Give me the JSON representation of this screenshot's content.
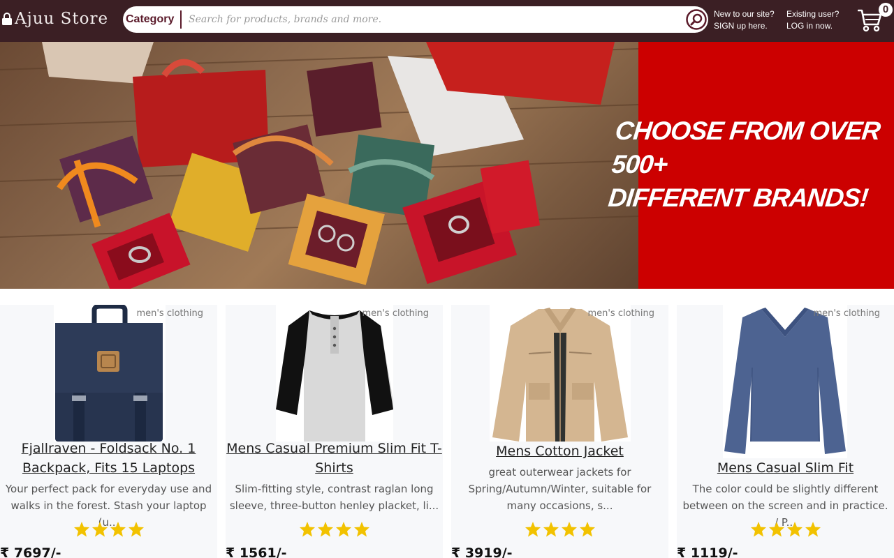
{
  "header": {
    "brand": "Ajuu Store",
    "category_label": "Category",
    "search_placeholder": "Search for products, brands and more.",
    "signup_line1": "New to our site?",
    "signup_line2": "SIGN up here.",
    "login_line1": "Existing user?",
    "login_line2": "LOG in now.",
    "cart_count": "0",
    "colors": {
      "bar": "#3b1f24",
      "accent": "#5a1a2a"
    }
  },
  "banner": {
    "line1": "CHOOSE FROM OVER",
    "line2": "500+",
    "line3": "DIFFERENT BRANDS!",
    "colors": {
      "panel": "#cc0000"
    }
  },
  "products": [
    {
      "category": "men's clothing",
      "title": "Fjallraven - Foldsack No. 1 Backpack, Fits 15 Laptops",
      "description": "Your perfect pack for everyday use and walks in the forest. Stash your laptop (u...",
      "rating": 4,
      "price": "₹ 7697/-",
      "icon": "backpack-image"
    },
    {
      "category": "men's clothing",
      "title": "Mens Casual Premium Slim Fit T-Shirts",
      "description": "Slim-fitting style, contrast raglan long sleeve, three-button henley placket, li...",
      "rating": 4,
      "price": "₹ 1561/-",
      "icon": "raglan-tshirt-image"
    },
    {
      "category": "men's clothing",
      "title": "Mens Cotton Jacket",
      "description": "great outerwear jackets for Spring/Autumn/Winter, suitable for many occasions, s...",
      "rating": 4,
      "price": "₹ 3919/-",
      "icon": "cotton-jacket-image"
    },
    {
      "category": "men's clothing",
      "title": "Mens Casual Slim Fit",
      "description": "The color could be slightly different between on the screen and in practice. / P...",
      "rating": 4,
      "price": "₹ 1119/-",
      "icon": "slim-fit-shirt-image"
    }
  ]
}
